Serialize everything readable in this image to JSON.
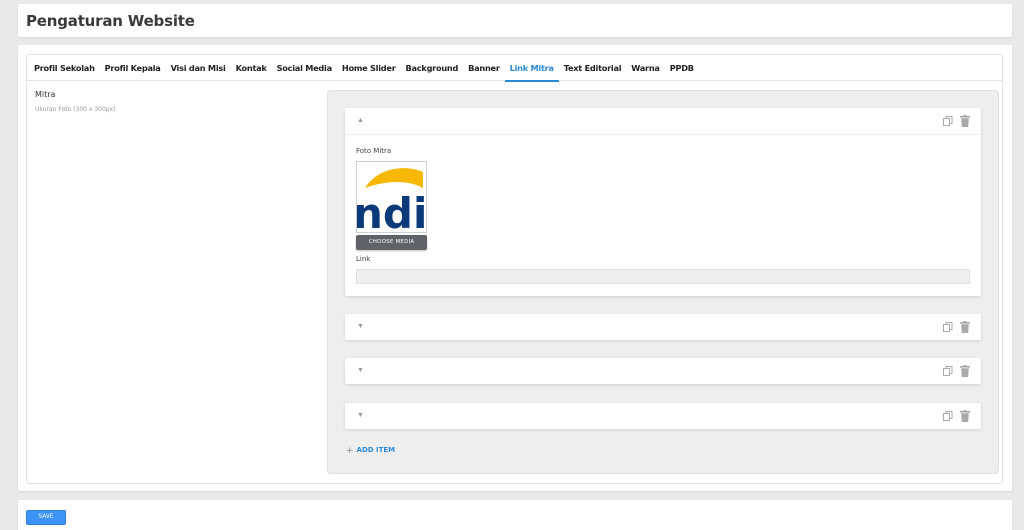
{
  "page": {
    "title": "Pengaturan Website"
  },
  "tabs": [
    {
      "label": "Profil Sekolah"
    },
    {
      "label": "Profil Kepala"
    },
    {
      "label": "Visi dan Misi"
    },
    {
      "label": "Kontak"
    },
    {
      "label": "Social Media"
    },
    {
      "label": "Home Slider"
    },
    {
      "label": "Background"
    },
    {
      "label": "Banner"
    },
    {
      "label": "Link Mitra",
      "active": true
    },
    {
      "label": "Text Editorial"
    },
    {
      "label": "Warna"
    },
    {
      "label": "PPDB"
    }
  ],
  "field": {
    "label": "Mitra",
    "description": "Ukuran Foto (300 x 300px)"
  },
  "repeater": {
    "items": [
      {
        "expanded": true,
        "toggle_icon": "caret-up-icon",
        "photo_label": "Foto Mitra",
        "logo_text": "ndi",
        "choose_media_label": "CHOOSE MEDIA",
        "link_label": "Link",
        "link_value": ""
      },
      {
        "expanded": false,
        "toggle_icon": "caret-down-icon"
      },
      {
        "expanded": false,
        "toggle_icon": "caret-down-icon"
      },
      {
        "expanded": false,
        "toggle_icon": "caret-down-icon"
      }
    ],
    "add_item_label": "ADD ITEM"
  },
  "footer": {
    "save_label": "SAVE"
  },
  "colors": {
    "accent": "#2b8ad8",
    "save_button": "#3d94f6",
    "logo_yellow": "#f6b800",
    "logo_navy": "#0b3a7a"
  }
}
